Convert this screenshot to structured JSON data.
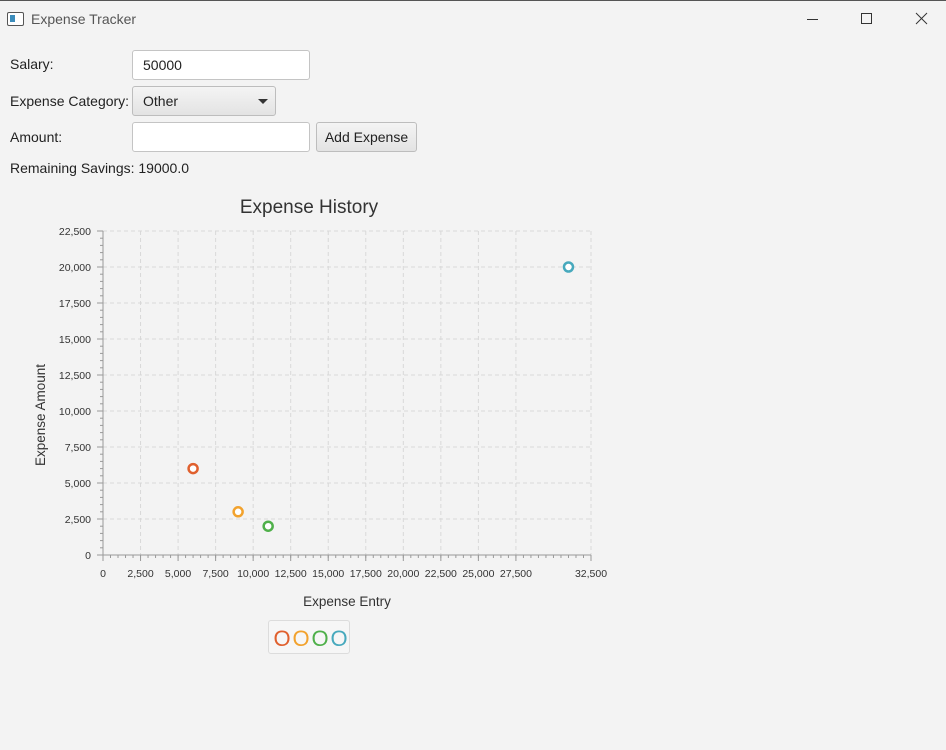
{
  "window": {
    "title": "Expense Tracker",
    "icon": "app-window-icon",
    "controls": [
      "minimize-icon",
      "maximize-icon",
      "close-icon"
    ]
  },
  "form": {
    "salary_label": "Salary:",
    "salary_value": "50000",
    "category_label": "Expense Category:",
    "category_value": "Other",
    "amount_label": "Amount:",
    "amount_value": "",
    "add_button_label": "Add Expense",
    "savings_text": "Remaining Savings: 19000.0"
  },
  "chart_data": {
    "type": "scatter",
    "title": "Expense History",
    "xlabel": "Expense Entry",
    "ylabel": "Expense Amount",
    "xlim": [
      0,
      32500
    ],
    "ylim": [
      0,
      22500
    ],
    "x_ticks": [
      0,
      2500,
      5000,
      7500,
      10000,
      12500,
      15000,
      17500,
      20000,
      22500,
      25000,
      27500,
      32500
    ],
    "x_tick_labels": [
      "0",
      "2,500",
      "5,000",
      "7,500",
      "10,000",
      "12,500",
      "15,000",
      "17,500",
      "20,000",
      "22,500",
      "25,000",
      "27,500",
      "32,500"
    ],
    "y_ticks": [
      0,
      2500,
      5000,
      7500,
      10000,
      12500,
      15000,
      17500,
      20000,
      22500
    ],
    "y_tick_labels": [
      "0",
      "2,500",
      "5,000",
      "7,500",
      "10,000",
      "12,500",
      "15,000",
      "17,500",
      "20,000",
      "22,500"
    ],
    "grid": true,
    "legend_position": "bottom",
    "series": [
      {
        "color": "#e0602e",
        "x": [
          6000
        ],
        "y": [
          6000
        ]
      },
      {
        "color": "#f2a22d",
        "x": [
          9000
        ],
        "y": [
          3000
        ]
      },
      {
        "color": "#4fb04a",
        "x": [
          11000
        ],
        "y": [
          2000
        ]
      },
      {
        "color": "#47a9bd",
        "x": [
          31000
        ],
        "y": [
          20000
        ]
      }
    ],
    "legend_symbol": "O"
  }
}
